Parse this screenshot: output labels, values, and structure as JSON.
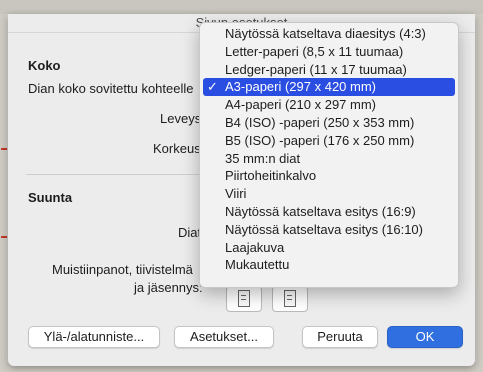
{
  "dialog": {
    "title": "Sivun asetukset"
  },
  "size_section": {
    "title": "Koko",
    "fit_label": "Dian koko sovitettu kohteelle",
    "width_label": "Leveys",
    "height_label": "Korkeus"
  },
  "orientation_section": {
    "title": "Suunta",
    "slides_label": "Diat",
    "notes_label_line1": "Muistiinpanot, tiivistelmä",
    "notes_label_line2": "ja jäsennys:"
  },
  "buttons": {
    "header_footer": "Ylä-/alatunniste...",
    "options": "Asetukset...",
    "cancel": "Peruuta",
    "ok": "OK"
  },
  "size_menu": {
    "selected_index": 3,
    "checkmark": "✓",
    "items": [
      "Näytössä katseltava diaesitys (4:3)",
      "Letter-paperi (8,5 x 11 tuumaa)",
      "Ledger-paperi (11 x 17 tuumaa)",
      "A3-paperi (297 x 420 mm)",
      "A4-paperi (210 x 297 mm)",
      "B4 (ISO) -paperi (250 x 353 mm)",
      "B5 (ISO) -paperi (176 x 250 mm)",
      "35 mm:n diat",
      "Piirtoheitinkalvo",
      "Viiri",
      "Näytössä katseltava esitys (16:9)",
      "Näytössä katseltava esitys (16:10)",
      "Laajakuva",
      "Mukautettu"
    ]
  },
  "colors": {
    "accent": "#2b4ee2",
    "ok_button": "#2f6fe0"
  }
}
